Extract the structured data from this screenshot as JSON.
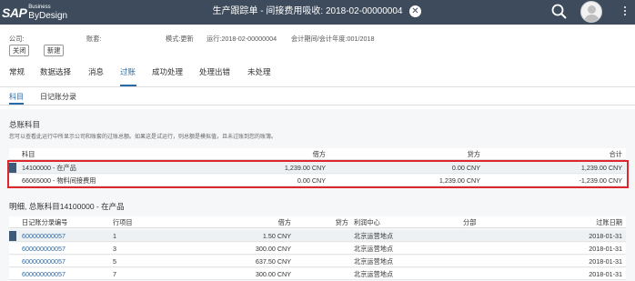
{
  "header": {
    "logo_sap": "SAP",
    "logo_business": "Business",
    "logo_bydesign": "ByDesign",
    "title": "生产跟踪单 - 间接费用吸收: 2018-02-00000004",
    "close_symbol": "✕"
  },
  "info": {
    "company_label": "公司:",
    "account_set_label": "账套:",
    "mode": "模式:更新",
    "run": "运行:2018-02-00000004",
    "period": "会计期间/会计年度:001/2018"
  },
  "buttons": {
    "close": "关闭",
    "new": "新建"
  },
  "tabs": [
    "常规",
    "数据选择",
    "消息",
    "过账",
    "成功处理",
    "处理出错",
    "未处理"
  ],
  "subtabs": [
    "科目",
    "日记账分录"
  ],
  "section1": {
    "title": "总账科目",
    "description": "您可以查看此运行中所显示公司和账套的过账总额。如果这是试运行，则总额是模拟值，且未过账到您的账簿。",
    "columns": [
      "科目",
      "借方",
      "贷方",
      "合计"
    ],
    "rows": [
      {
        "account": "14100000 - 在产品",
        "debit": "1,239.00 CNY",
        "credit": "0.00 CNY",
        "total": "1,239.00 CNY"
      },
      {
        "account": "66065000 - 物料间接费用",
        "debit": "0.00 CNY",
        "credit": "1,239.00 CNY",
        "total": "-1,239.00 CNY"
      }
    ]
  },
  "section2": {
    "title": "明细, 总账科目14100000 - 在产品",
    "columns": [
      "日记账分录编号",
      "行项目",
      "借方",
      "贷方",
      "利润中心",
      "分部",
      "过账日期"
    ],
    "rows": [
      {
        "entry": "600000000057",
        "line": "1",
        "debit": "1.50 CNY",
        "credit": "",
        "profit_center": "北京运营地点",
        "segment": "",
        "date": "2018-01-31"
      },
      {
        "entry": "600000000057",
        "line": "3",
        "debit": "300.00 CNY",
        "credit": "",
        "profit_center": "北京运营地点",
        "segment": "",
        "date": "2018-01-31"
      },
      {
        "entry": "600000000057",
        "line": "5",
        "debit": "637.50 CNY",
        "credit": "",
        "profit_center": "北京运营地点",
        "segment": "",
        "date": "2018-01-31"
      },
      {
        "entry": "600000000057",
        "line": "7",
        "debit": "300.00 CNY",
        "credit": "",
        "profit_center": "北京运营地点",
        "segment": "",
        "date": "2018-01-31"
      }
    ]
  },
  "colors": {
    "header_bg": "#3d4b5c",
    "accent": "#2a6aa8",
    "highlight_border": "#e0262d"
  },
  "icons": [
    "close-icon",
    "search-icon",
    "user-avatar-icon",
    "more-menu-icon"
  ]
}
